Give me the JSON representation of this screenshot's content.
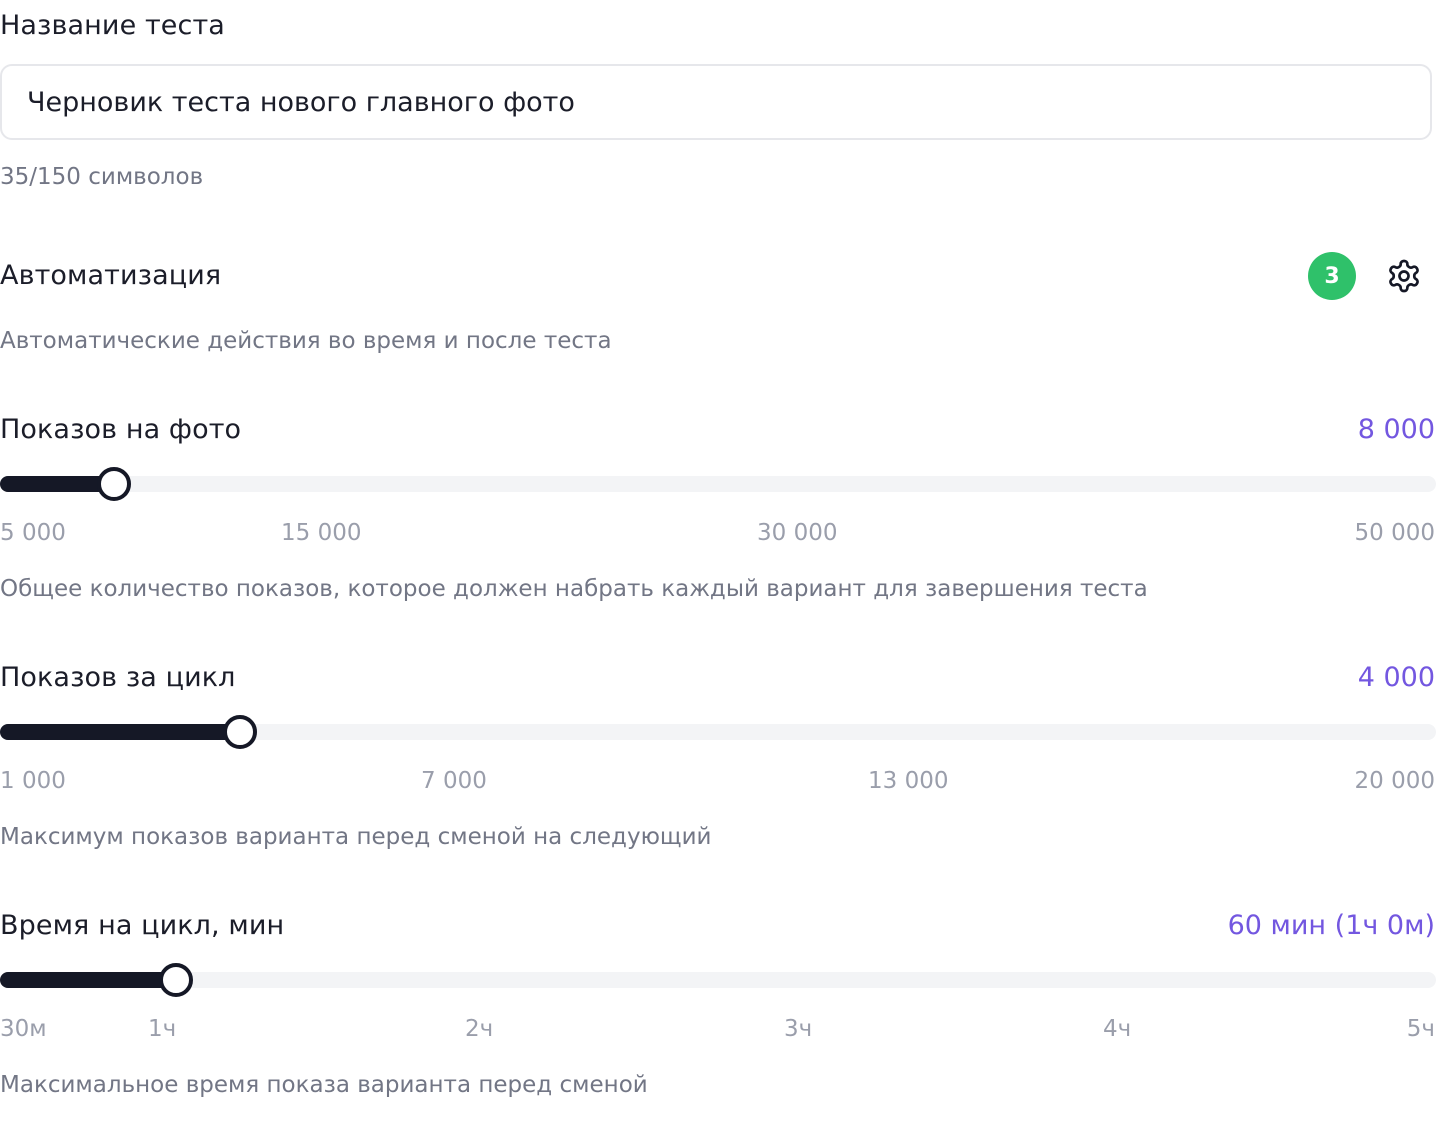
{
  "test_name": {
    "label": "Название теста",
    "value": "Черновик теста нового главного фото",
    "counter": "35/150 символов"
  },
  "automation": {
    "title": "Автоматизация",
    "badge": "3",
    "description": "Автоматические действия во время и после теста",
    "badge_color": "#2fc16a"
  },
  "sliders": [
    {
      "label": "Показов на фото",
      "value_text": "8 000",
      "value": 8000,
      "min": 5000,
      "max": 50000,
      "ticks": [
        "5 000",
        "15 000",
        "30 000",
        "50 000"
      ],
      "description": "Общее количество показов, которое должен набрать каждый вариант для завершения теста"
    },
    {
      "label": "Показов за цикл",
      "value_text": "4 000",
      "value": 4000,
      "min": 1000,
      "max": 20000,
      "ticks": [
        "1 000",
        "7 000",
        "13 000",
        "20 000"
      ],
      "description": "Максимум показов варианта перед сменой на следующий"
    },
    {
      "label": "Время на цикл, мин",
      "value_text": "60 мин (1ч 0м)",
      "value": 60,
      "min": 30,
      "max": 300,
      "ticks": [
        "30м",
        "1ч",
        "2ч",
        "3ч",
        "4ч",
        "5ч"
      ],
      "description": "Максимальное время показа варианта перед сменой"
    }
  ],
  "colors": {
    "accent": "#7357e0",
    "track_fill": "#151826",
    "track_bg": "#f3f4f6"
  }
}
